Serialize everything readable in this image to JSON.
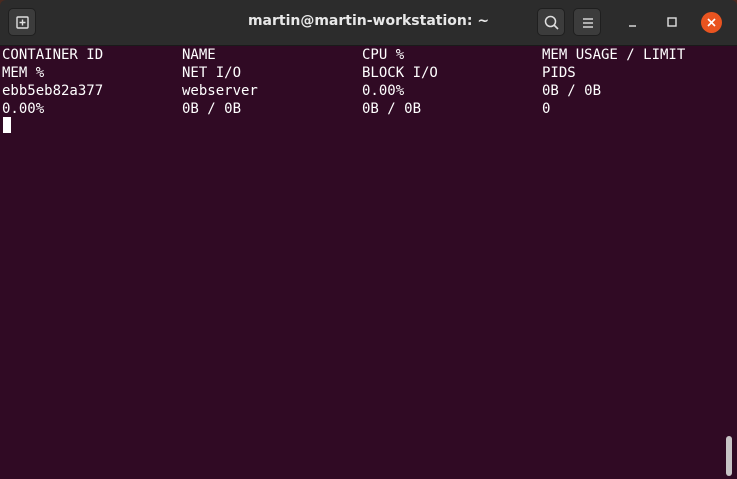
{
  "window": {
    "title": "martin@martin-workstation: ~"
  },
  "toolbar": {
    "new_tab_icon": "new-tab-icon",
    "search_icon": "search-icon",
    "menu_icon": "hamburger-menu-icon",
    "minimize_icon": "minimize-icon",
    "maximize_icon": "maximize-icon",
    "close_icon": "close-icon"
  },
  "colors": {
    "terminal_bg": "#300a24",
    "titlebar_bg": "#2c2c2c",
    "close_accent": "#e95420",
    "text": "#ffffff"
  },
  "terminal": {
    "header": {
      "col1": "CONTAINER ID",
      "col2": "NAME",
      "col3": "CPU %",
      "col4": "MEM USAGE / LIMIT"
    },
    "header2": {
      "col1": "MEM %",
      "col2": "NET I/O",
      "col3": "BLOCK I/O",
      "col4": "PIDS"
    },
    "row1": {
      "col1": "ebb5eb82a377",
      "col2": "webserver",
      "col3": "0.00%",
      "col4": "0B / 0B"
    },
    "row2": {
      "col1": "0.00%",
      "col2": "0B / 0B",
      "col3": "0B / 0B",
      "col4": "0"
    }
  }
}
